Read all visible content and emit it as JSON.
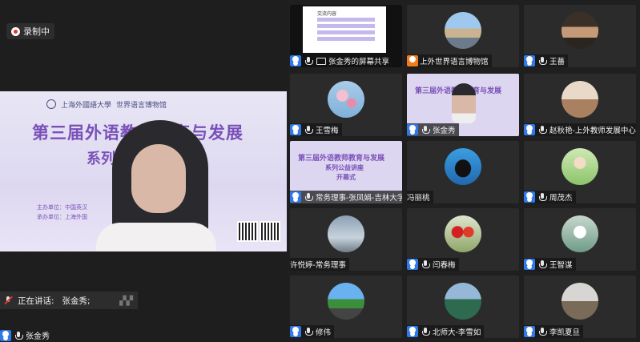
{
  "recording": {
    "label": "录制中"
  },
  "main": {
    "slide_logo_left": "上海外國語大學",
    "slide_logo_right": "世界语言博物馆",
    "slide_title": "第三届外语教师教育与发展",
    "slide_subtitle": "系列   座",
    "slide_host": "主办单位：中国英汉",
    "slide_organizer": "承办单位：上海外国",
    "speaking_label": "正在讲话:",
    "speaking_name": "张金秀;"
  },
  "self": {
    "name": "张金秀"
  },
  "share_tile": {
    "doc_title": "交流内容"
  },
  "mini_slide": {
    "title": "第三届外语教师教育与发展",
    "sub": "系列公益讲座",
    "sub2": "开幕式"
  },
  "participants": [
    {
      "name": "张金秀的屏幕共享",
      "type": "screen",
      "icon": "user-icon",
      "avatar": "screen-share",
      "active": true
    },
    {
      "name": "上外世界语言博物馆",
      "type": "orange",
      "icon": "host-icon",
      "avatar": "building",
      "active": false
    },
    {
      "name": "王薔",
      "type": "user",
      "icon": "user-icon",
      "avatar": "portrait-dark",
      "active": false
    },
    {
      "name": "王雪梅",
      "type": "user",
      "icon": "user-icon",
      "avatar": "blossom",
      "active": false
    },
    {
      "name": "张金秀",
      "type": "user",
      "icon": "user-icon",
      "avatar": "video-slide",
      "active": true
    },
    {
      "name": "赵秋艳-上外教师发展中心",
      "type": "user",
      "icon": "user-icon",
      "avatar": "office",
      "active": false
    },
    {
      "name": "常务理事-张凤娟-吉林大学",
      "type": "user",
      "icon": "user-icon",
      "avatar": "slide",
      "active": false
    },
    {
      "name": "冯丽桃",
      "type": "none",
      "icon": "",
      "avatar": "orca",
      "active": false
    },
    {
      "name": "周茂杰",
      "type": "user",
      "icon": "user-icon",
      "avatar": "cartoon",
      "active": false
    },
    {
      "name": "许悦婷-常务理事",
      "type": "none",
      "icon": "",
      "avatar": "sky",
      "active": false
    },
    {
      "name": "闫春梅",
      "type": "user",
      "icon": "user-icon",
      "avatar": "tulips",
      "active": false
    },
    {
      "name": "王智谋",
      "type": "user",
      "icon": "user-icon",
      "avatar": "flowers",
      "active": false
    },
    {
      "name": "修伟",
      "type": "user",
      "icon": "user-icon",
      "avatar": "road",
      "active": false
    },
    {
      "name": "北师大-李雪如",
      "type": "user",
      "icon": "user-icon",
      "avatar": "landscape",
      "active": false
    },
    {
      "name": "李凯夏旦",
      "type": "user",
      "icon": "user-icon",
      "avatar": "room",
      "active": false
    }
  ],
  "colors": {
    "active_border": "#28c16b",
    "user_icon": "#2f79e8",
    "host_icon": "#f07c1a",
    "muted": "#e0392b"
  }
}
